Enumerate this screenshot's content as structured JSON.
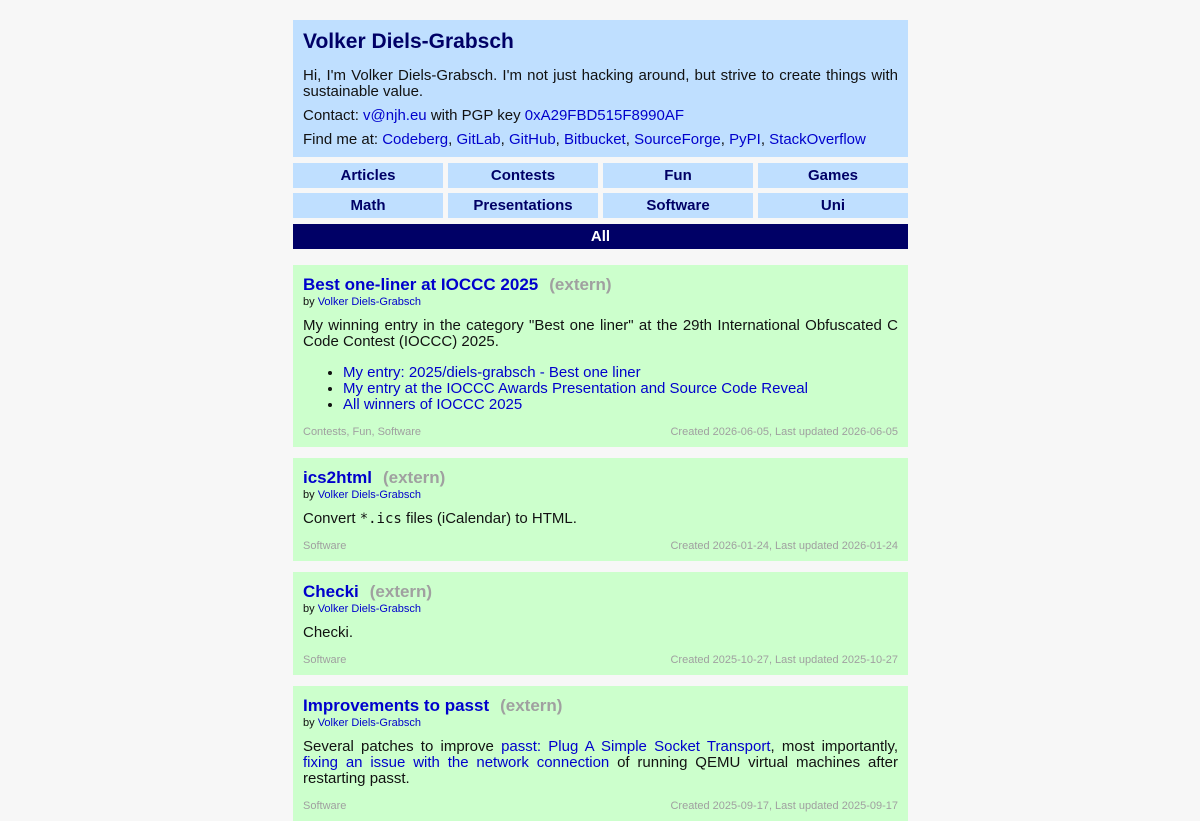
{
  "header": {
    "title": "Volker Diels-Grabsch",
    "intro": "Hi, I'm Volker Diels-Grabsch. I'm not just hacking around, but strive to create things with sustainable value.",
    "contact_prefix": "Contact:",
    "email": "v@njh.eu",
    "pgp_text": "with PGP key",
    "pgp_key": "0xA29FBD515F8990AF",
    "find_prefix": "Find me at:",
    "profiles": [
      "Codeberg",
      "GitLab",
      "GitHub",
      "Bitbucket",
      "SourceForge",
      "PyPI",
      "StackOverflow"
    ]
  },
  "nav": {
    "items": [
      "Articles",
      "Contests",
      "Fun",
      "Games",
      "Math",
      "Presentations",
      "Software",
      "Uni"
    ],
    "all_label": "All"
  },
  "articles": [
    {
      "title": "Best one-liner at IOCCC 2025",
      "extern": "(extern)",
      "by_prefix": "by",
      "author": "Volker Diels-Grabsch",
      "description": "My winning entry in the category \"Best one liner\" at the 29th International Obfuscated C Code Contest (IOCCC) 2025.",
      "links": [
        "My entry: 2025/diels-grabsch - Best one liner",
        "My entry at the IOCCC Awards Presentation and Source Code Reveal",
        "All winners of IOCCC 2025"
      ],
      "tags": "Contests, Fun, Software",
      "dates": "Created 2026-06-05, Last updated 2026-06-05"
    },
    {
      "title": "ics2html",
      "extern": "(extern)",
      "by_prefix": "by",
      "author": "Volker Diels-Grabsch",
      "desc_before": "Convert",
      "desc_code": "*.ics",
      "desc_after": "files (iCalendar) to HTML.",
      "tags": "Software",
      "dates": "Created 2026-01-24, Last updated 2026-01-24"
    },
    {
      "title": "Checki",
      "extern": "(extern)",
      "by_prefix": "by",
      "author": "Volker Diels-Grabsch",
      "description": "Checki.",
      "tags": "Software",
      "dates": "Created 2025-10-27, Last updated 2025-10-27"
    },
    {
      "title": "Improvements to passt",
      "extern": "(extern)",
      "by_prefix": "by",
      "author": "Volker Diels-Grabsch",
      "desc_1": "Several patches to improve",
      "link_1": "passt: Plug A Simple Socket Transport",
      "desc_2": ", most importantly,",
      "link_2": "fixing an issue with the network connection",
      "desc_3": "of running QEMU virtual machines after restarting passt.",
      "tags": "Software",
      "dates": "Created 2025-09-17, Last updated 2025-09-17"
    }
  ]
}
